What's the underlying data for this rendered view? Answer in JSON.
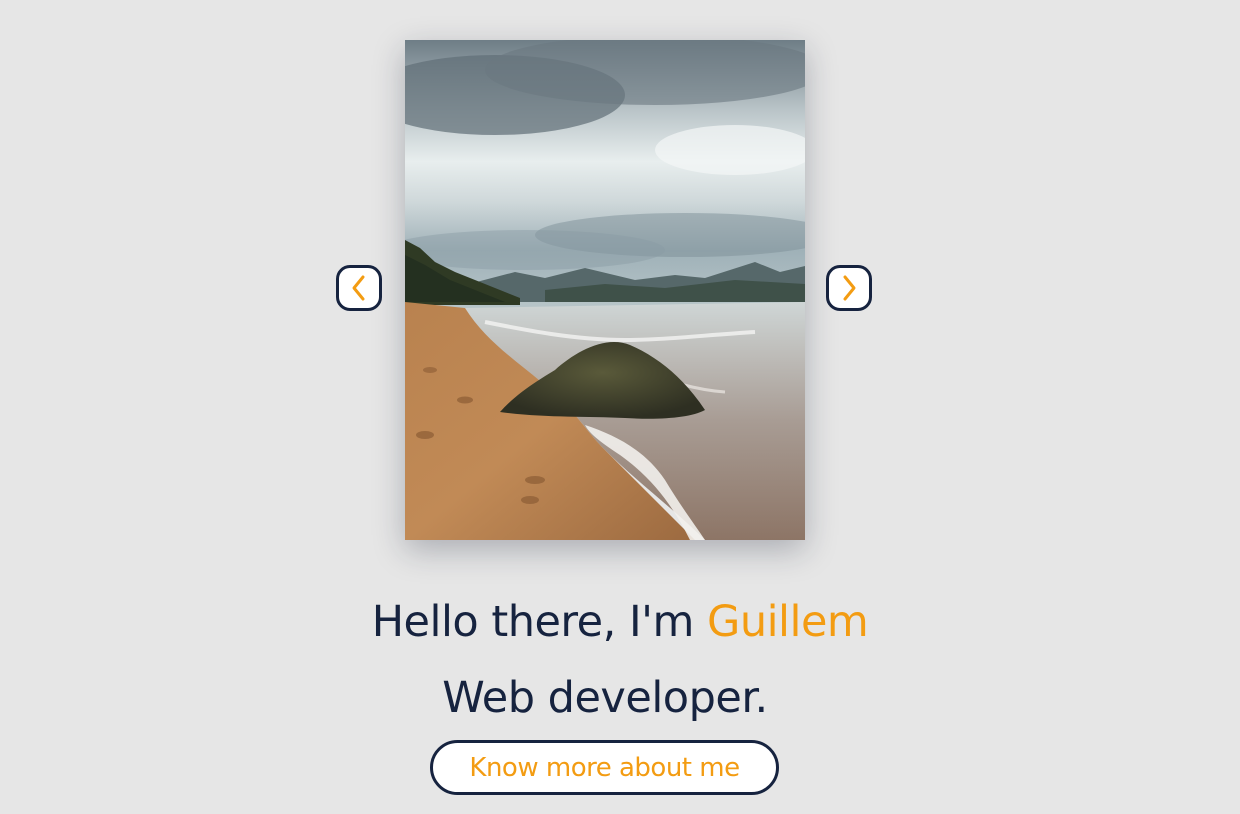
{
  "hero": {
    "greeting_prefix": "Hello there, I'm",
    "name": "Guillem",
    "role": "Web developer.",
    "cta_label": "Know more about me"
  },
  "carousel": {
    "image_subject": "beach-with-rock-photo",
    "prev_icon": "chevron-left-icon",
    "next_icon": "chevron-right-icon"
  },
  "colors": {
    "background": "#e6e6e6",
    "text": "#16233f",
    "accent": "#f39c12",
    "border": "#16233f"
  }
}
